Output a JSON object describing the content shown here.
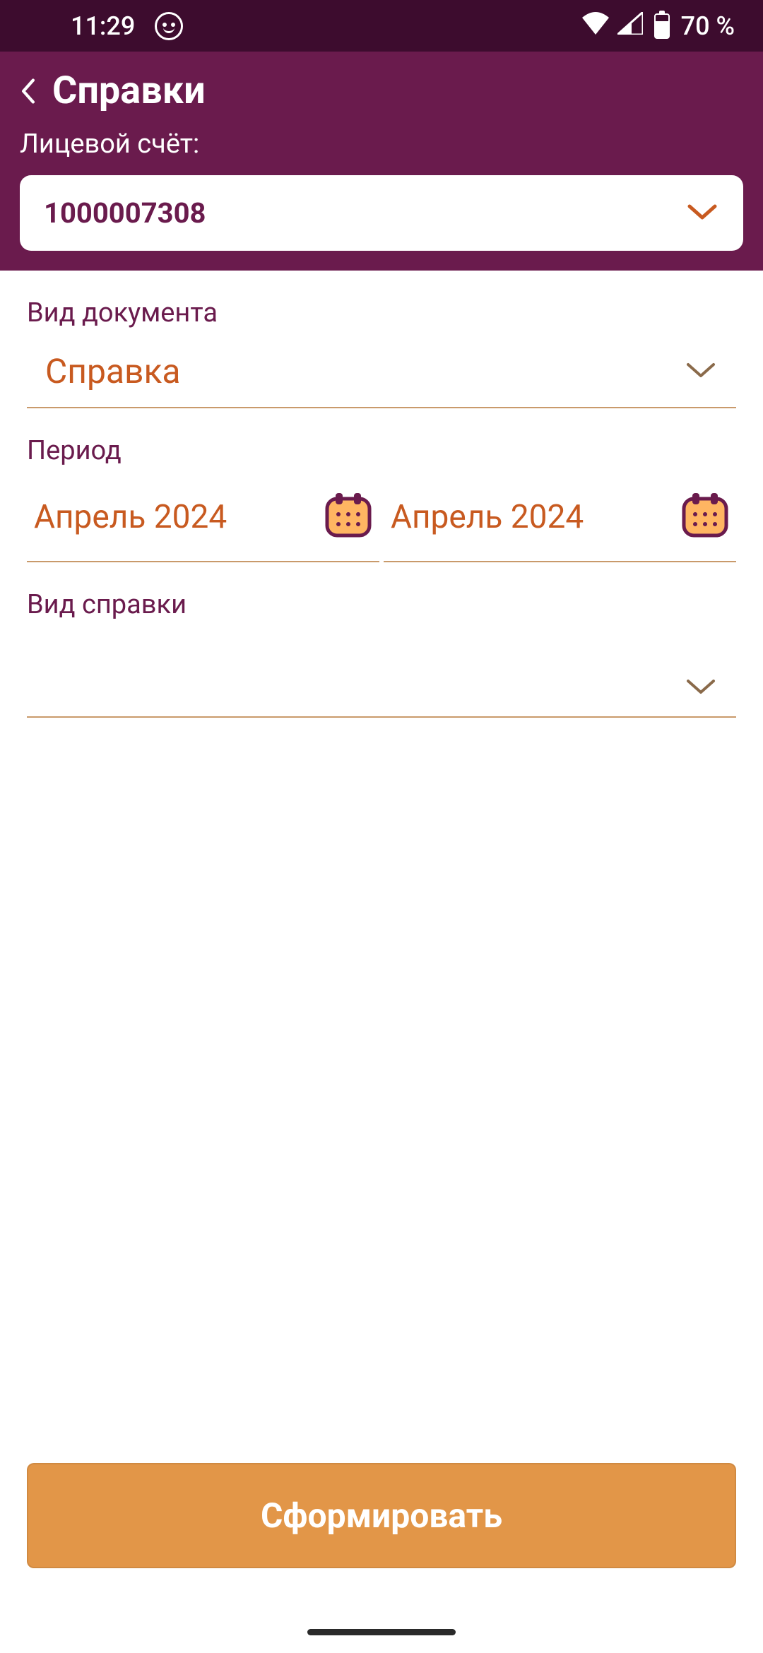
{
  "status": {
    "time": "11:29",
    "battery": "70 %"
  },
  "header": {
    "title": "Справки",
    "account_label": "Лицевой счёт:",
    "account_value": "1000007308"
  },
  "form": {
    "doc_type_label": "Вид документа",
    "doc_type_value": "Справка",
    "period_label": "Период",
    "period_from": "Апрель 2024",
    "period_to": "Апрель 2024",
    "ref_type_label": "Вид справки",
    "ref_type_value": "",
    "submit_label": "Сформировать"
  }
}
